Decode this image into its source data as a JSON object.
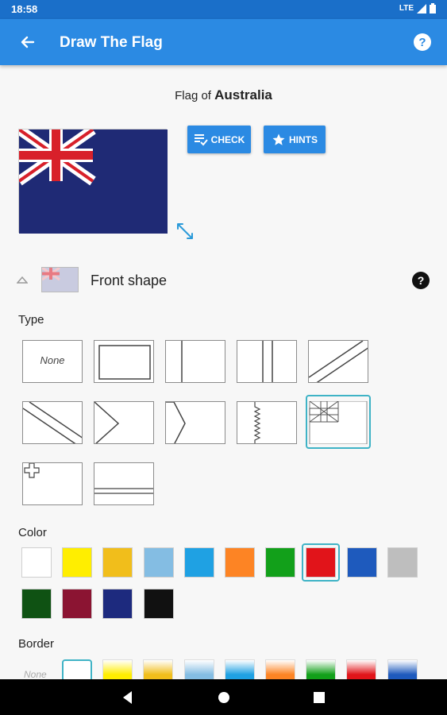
{
  "status_bar": {
    "time": "18:58",
    "network": "LTE"
  },
  "app_bar": {
    "title": "Draw The Flag",
    "back_icon": "arrow-back-icon",
    "help_icon": "help-circle-icon"
  },
  "heading": {
    "prefix": "Flag of",
    "country": "Australia"
  },
  "actions": {
    "check_label": "CHECK",
    "hints_label": "HINTS"
  },
  "front_shape": {
    "label": "Front shape"
  },
  "type_section": {
    "label": "Type",
    "options": [
      {
        "id": "none",
        "text": "None"
      },
      {
        "id": "border-frame"
      },
      {
        "id": "vertical-stripe"
      },
      {
        "id": "double-vertical-stripe"
      },
      {
        "id": "diagonal-up"
      },
      {
        "id": "diagonal-down"
      },
      {
        "id": "chevron-left"
      },
      {
        "id": "hoist-triangle"
      },
      {
        "id": "serrated-band"
      },
      {
        "id": "union-jack-canton",
        "selected": true
      },
      {
        "id": "cross-canton"
      },
      {
        "id": "horizontal-band"
      }
    ]
  },
  "color_section": {
    "label": "Color",
    "colors": [
      {
        "hex": "#ffffff"
      },
      {
        "hex": "#ffee00"
      },
      {
        "hex": "#f1be1b"
      },
      {
        "hex": "#84bde3"
      },
      {
        "hex": "#1fa1e3"
      },
      {
        "hex": "#fd8424"
      },
      {
        "hex": "#12a01a"
      },
      {
        "hex": "#e1141a",
        "selected": true
      },
      {
        "hex": "#1e5abd"
      },
      {
        "hex": "#bebebe"
      },
      {
        "hex": "#0f5213"
      },
      {
        "hex": "#8b1432"
      },
      {
        "hex": "#1d2a7e"
      },
      {
        "hex": "#111111"
      }
    ]
  },
  "border_section": {
    "label": "Border",
    "none_text": "None",
    "colors": [
      "#ffffff",
      "#ffee00",
      "#f1be1b",
      "#84bde3",
      "#1fa1e3",
      "#fd8424",
      "#12a01a",
      "#e1141a",
      "#1e5abd"
    ]
  }
}
